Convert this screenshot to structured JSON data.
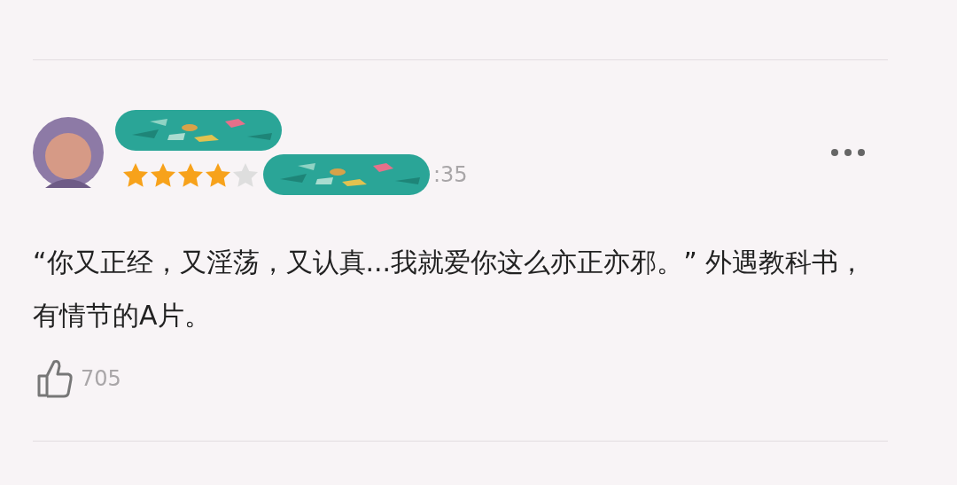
{
  "review": {
    "stars": 4,
    "time": ":35",
    "text": "“你又正经，又淫荡，又认真...我就爱你这么亦正亦邪。” 外遇教科书，有情节的A片。",
    "likes": "705"
  }
}
